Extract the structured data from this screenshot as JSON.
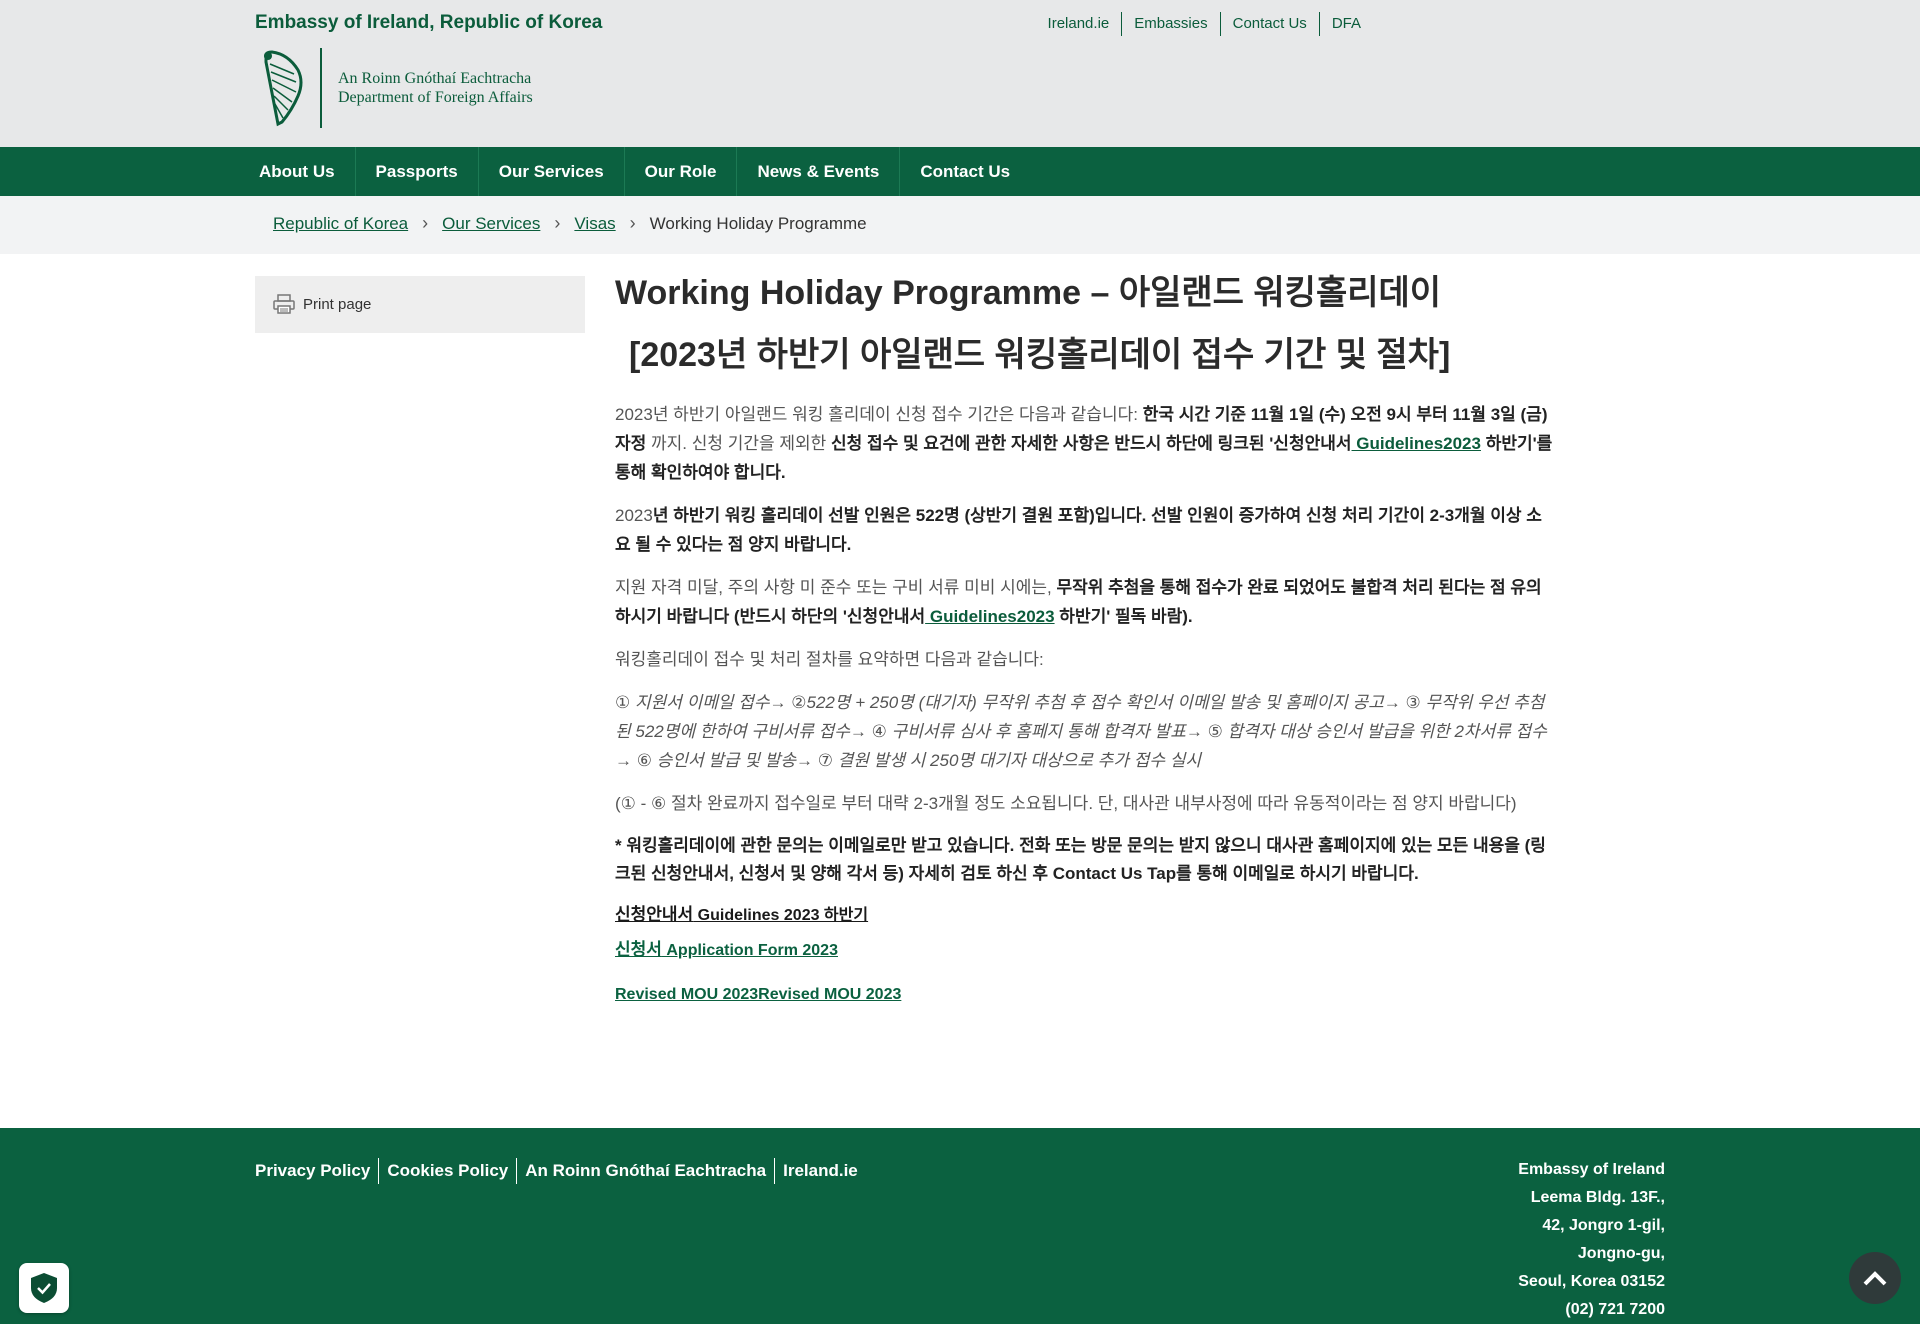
{
  "header": {
    "embassy_name": "Embassy of Ireland, Republic of Korea",
    "logo_line1": "An Roinn Gnóthaí Eachtracha",
    "logo_line2": "Department of Foreign Affairs",
    "top_links": [
      "Ireland.ie",
      "Embassies",
      "Contact Us",
      "DFA"
    ]
  },
  "nav": {
    "items": [
      "About Us",
      "Passports",
      "Our Services",
      "Our Role",
      "News & Events",
      "Contact Us"
    ]
  },
  "breadcrumb": {
    "items": [
      "Republic of Korea",
      "Our Services",
      "Visas"
    ],
    "current": "Working Holiday Programme"
  },
  "sidebar": {
    "print_label": "Print page"
  },
  "main": {
    "title": "Working Holiday Programme – 아일랜드 워킹홀리데이",
    "subtitle": "[2023년 하반기 아일랜드 워킹홀리데이 접수 기간 및 절차]",
    "p1_a": "2023년 하반기 아일랜드 워킹 홀리데이 신청 접수 기간은 다음과 같습니다: ",
    "p1_b": "한국 시간 기준 11월 1일 (수) 오전 9시 부터 11월 3일 (금) 자정",
    "p1_c": " 까지. 신청 기간을 제외한 ",
    "p1_d": "신청 접수 및 요건에 관한 자세한 사항은 반드시 하단에 링크된 '신청안내서",
    "p1_link": " Guidelines2023",
    "p1_e": " 하반기'를 통해 확인하여야 합니다.",
    "p2_a": "2023",
    "p2_b": "년 하반기 워킹 홀리데이 선발 인원은 522명 (상반기 결원 포함)입니다. 선발 인원이 증가하여 신청 처리 기간이 2-3개월 이상 소요 될 수 있다는 점 양지 바랍니다.",
    "p3_a": "지원 자격 미달, 주의 사항 미 준수 또는 구비 서류 미비 시에는, ",
    "p3_b": "무작위 추첨을 통해 접수가 완료 되었어도 불합격 처리 된다는 점 유의하시기 바랍니다 (반드시 하단의 '신청안내서",
    "p3_link": " Guidelines2023",
    "p3_c": " 하반기' 필독 바람).",
    "p4": "워킹홀리데이 접수 및 처리 절차를 요약하면 다음과 같습니다:",
    "p5": "① 지원서 이메일 접수→ ②522명 + 250명 (대기자) 무작위 추첨 후 접수 확인서 이메일 발송 및 홈페이지 공고→ ③ 무작위 우선 추첨 된 522명에 한하여 구비서류 접수→ ④ 구비서류 심사 후 홈페지 통해 합격자 발표→ ⑤ 합격자 대상 승인서 발급을 위한 2차서류 접수→ ⑥ 승인서 발급 및 발송→ ⑦ 결원 발생 시 250명 대기자 대상으로 추가 접수 실시",
    "p6": "(① - ⑥ 절차 완료까지 접수일로 부터 대략 2-3개월 정도 소요됩니다. 단, 대사관 내부사정에 따라 유동적이라는 점 양지 바랍니다)",
    "notice": "* 워킹홀리데이에 관한 문의는 이메일로만 받고 있습니다. 전화 또는 방문 문의는 받지 않으니 대사관 홈페이지에 있는 모든 내용을 (링크된 신청안내서, 신청서 및 양해 각서 등) 자세히 검토 하신 후 Contact Us Tap를 통해 이메일로 하시기 바랍니다.",
    "link_guidelines_ko": "신청안내서",
    "link_guidelines_en": "  Guidelines 2023 하반기",
    "link_form_ko": "신청서",
    "link_form_en": "  Application Form  2023",
    "link_mou": "Revised MOU 2023Revised MOU 2023"
  },
  "footer": {
    "links": [
      "Privacy Policy",
      "Cookies Policy",
      "An Roinn Gnóthaí Eachtracha",
      "Ireland.ie"
    ],
    "address": [
      "Embassy of Ireland",
      "Leema Bldg. 13F.,",
      "42, Jongro 1-gil,",
      "Jongno-gu,",
      "Seoul, Korea 03152",
      "(02) 721 7200"
    ]
  },
  "colors": {
    "brand_green": "#0b6140",
    "header_bg": "#e7e8e9"
  }
}
